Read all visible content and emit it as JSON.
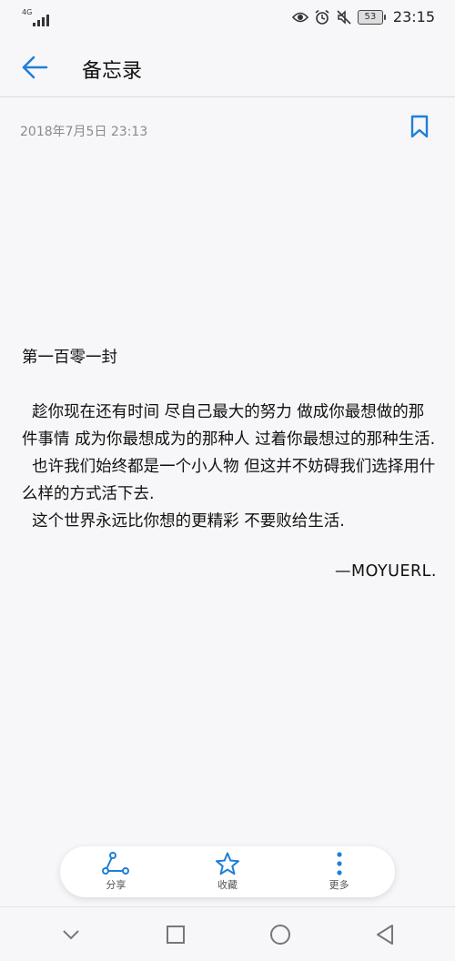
{
  "status_bar": {
    "network": "4G",
    "time": "23:15",
    "battery": "53",
    "icons": [
      "eye-icon",
      "alarm-icon",
      "mute-icon"
    ]
  },
  "header": {
    "title": "备忘录",
    "back_icon": "arrow-left-icon"
  },
  "note": {
    "date": "2018年7月5日  23:13",
    "bookmark_icon": "bookmark-icon",
    "title": "第一百零一封",
    "paragraphs": [
      "  趁你现在还有时间 尽自己最大的努力 做成你最想做的那件事情 成为你最想成为的那种人 过着你最想过的那种生活.",
      "  也许我们始终都是一个小人物 但这并不妨碍我们选择用什么样的方式活下去.",
      "  这个世界永远比你想的更精彩 不要败给生活."
    ],
    "signature": "—MOYUERL."
  },
  "actions": [
    {
      "label": "分享",
      "icon": "share-icon"
    },
    {
      "label": "收藏",
      "icon": "star-icon"
    },
    {
      "label": "更多",
      "icon": "more-vertical-icon"
    }
  ],
  "nav": {
    "icons": [
      "nav-down-icon",
      "nav-recents-icon",
      "nav-home-icon",
      "nav-back-icon"
    ]
  },
  "colors": {
    "accent": "#1e7fd8",
    "background": "#f7f7f9",
    "text": "#111111",
    "muted": "#8a8a8a"
  }
}
